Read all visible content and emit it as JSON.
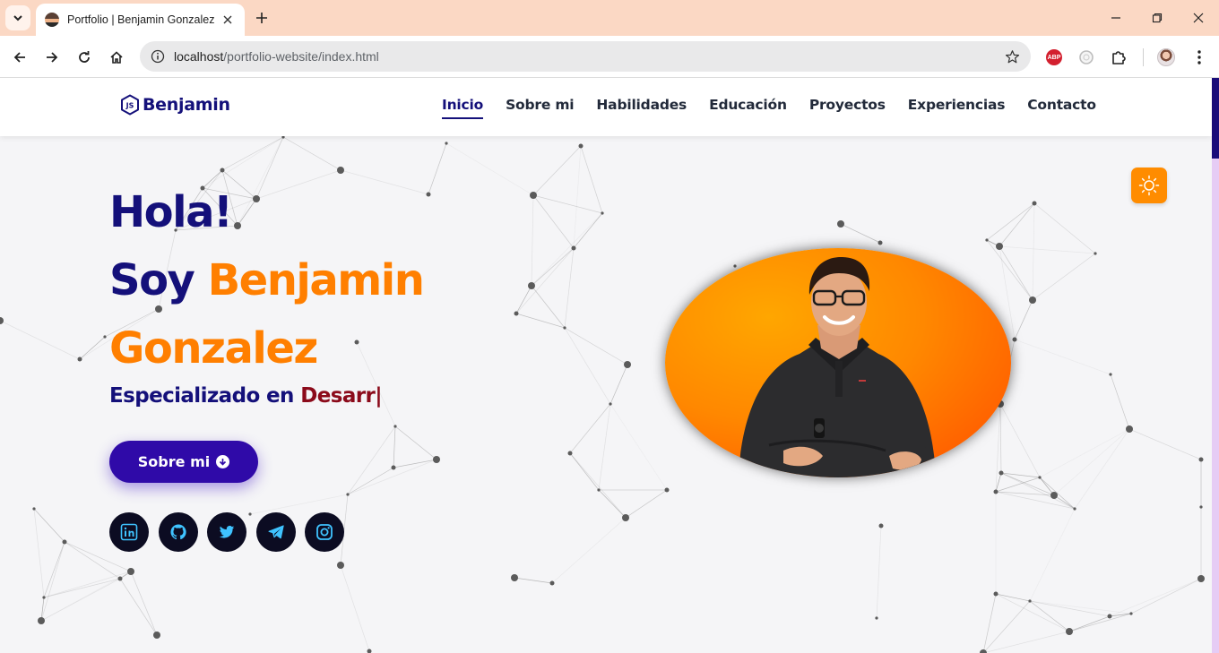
{
  "browser": {
    "tab_title": "Portfolio | Benjamin Gonzalez",
    "url_host": "localhost",
    "url_path": "/portfolio-website/index.html",
    "abp_label": "ABP"
  },
  "site": {
    "logo_text": "Benjamin",
    "logo_mark": "JS",
    "nav": [
      {
        "label": "Inicio",
        "active": true
      },
      {
        "label": "Sobre mi"
      },
      {
        "label": "Habilidades"
      },
      {
        "label": "Educación"
      },
      {
        "label": "Proyectos"
      },
      {
        "label": "Experiencias"
      },
      {
        "label": "Contacto"
      }
    ]
  },
  "hero": {
    "greeting": "Hola!",
    "intro": "Soy",
    "first_name": "Benjamin",
    "last_name": "Gonzalez",
    "subtitle_prefix": "Especializado en",
    "typed_text": "Desarr",
    "caret": "|",
    "about_button": "Sobre mi"
  },
  "socials": [
    {
      "name": "linkedin"
    },
    {
      "name": "github"
    },
    {
      "name": "twitter"
    },
    {
      "name": "telegram"
    },
    {
      "name": "instagram"
    }
  ],
  "colors": {
    "navy": "#14107a",
    "orange": "#ff7f00",
    "crimson": "#8b0a1a",
    "button_purple": "#2f0aa8",
    "social_bg": "#0c0c22",
    "social_icon": "#3fc3ff",
    "toggle_bg": "#ff8c00"
  }
}
